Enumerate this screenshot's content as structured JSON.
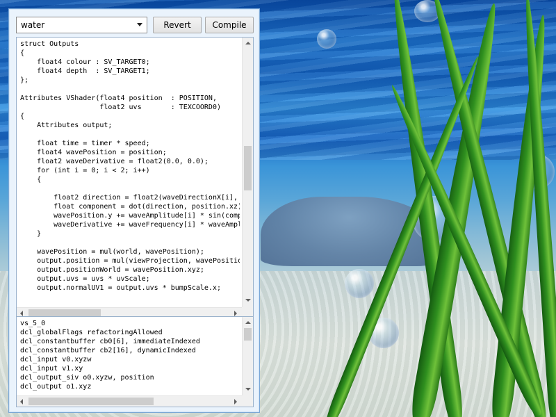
{
  "window": {
    "shader_select": {
      "value": "water"
    },
    "revert_label": "Revert",
    "compile_label": "Compile"
  },
  "source_code": [
    "struct Outputs",
    "{",
    "    float4 colour : SV_TARGET0;",
    "    float4 depth  : SV_TARGET1;",
    "};",
    "",
    "Attributes VShader(float4 position  : POSITION,",
    "                   float2 uvs       : TEXCOORD0)",
    "{",
    "    Attributes output;",
    "",
    "    float time = timer * speed;",
    "    float4 wavePosition = position;",
    "    float2 waveDerivative = float2(0.0, 0.0);",
    "    for (int i = 0; i < 2; i++)",
    "    {",
    "",
    "        float2 direction = float2(waveDirectionX[i],",
    "        float component = dot(direction, position.xz)",
    "        wavePosition.y += waveAmplitude[i] * sin(comp",
    "        waveDerivative += waveFrequency[i] * waveAmpl",
    "    }",
    "",
    "    wavePosition = mul(world, wavePosition);",
    "    output.position = mul(viewProjection, wavePositio",
    "    output.positionWorld = wavePosition.xyz;",
    "    output.uvs = uvs * uvScale;",
    "    output.normalUV1 = output.uvs * bumpScale.x;"
  ],
  "compiled_output": [
    "vs_5_0",
    "dcl_globalFlags refactoringAllowed",
    "dcl_constantbuffer cb0[6], immediateIndexed",
    "dcl_constantbuffer cb2[16], dynamicIndexed",
    "dcl_input v0.xyzw",
    "dcl_input v1.xy",
    "dcl_output_siv o0.xyzw, position",
    "dcl_output o1.xyz"
  ],
  "scroll": {
    "code_vertical_position": 0.45,
    "code_horizontal_position": 0.0,
    "output_vertical_position": 0.0,
    "output_horizontal_position": 0.0
  },
  "colors": {
    "window_bg": "#eaf3fc",
    "window_border": "#7aa7d6",
    "scroll_thumb": "#cdcdcd"
  },
  "icons": {
    "dropdown": "chevron-down-icon",
    "scroll_up": "arrow-up-icon",
    "scroll_down": "arrow-down-icon",
    "scroll_left": "arrow-left-icon",
    "scroll_right": "arrow-right-icon"
  }
}
